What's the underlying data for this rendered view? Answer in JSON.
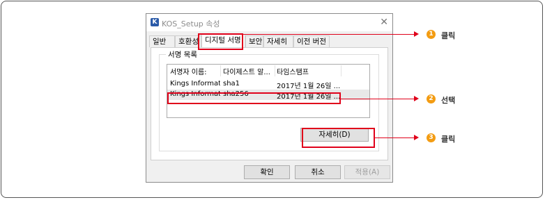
{
  "window": {
    "title": "KOS_Setup 속성",
    "close_glyph": "✕",
    "app_icon_letter": "K"
  },
  "tabs": [
    {
      "label": "일반"
    },
    {
      "label": "호환성"
    },
    {
      "label": "디지털 서명"
    },
    {
      "label": "보안"
    },
    {
      "label": "자세히"
    },
    {
      "label": "이전 버전"
    }
  ],
  "signatures": {
    "group_label": "서명 목록",
    "columns": [
      "서명자 이름:",
      "다이제스트 알...",
      "타임스탬프"
    ],
    "rows": [
      {
        "name": "Kings Informati...",
        "digest": "sha1",
        "timestamp": "2017년 1월 26일 ..."
      },
      {
        "name": "Kings Informati...",
        "digest": "sha256",
        "timestamp": "2017년 1월 26일 ..."
      }
    ],
    "details_button": "자세히(D)"
  },
  "footer": {
    "ok": "확인",
    "cancel": "취소",
    "apply": "적용(A)"
  },
  "callouts": [
    {
      "number": "1",
      "label": "클릭"
    },
    {
      "number": "2",
      "label": "선택"
    },
    {
      "number": "3",
      "label": "클릭"
    }
  ],
  "colors": {
    "highlight": "#e0001a",
    "callout_dot": "#f39c12"
  }
}
